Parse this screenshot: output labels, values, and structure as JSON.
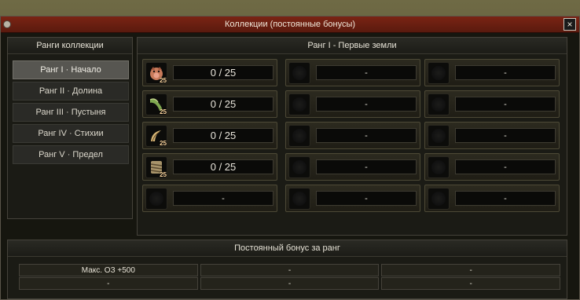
{
  "window": {
    "title": "Коллекции (постоянные бонусы)",
    "close_label": "×"
  },
  "ranks_panel": {
    "header": "Ранги коллекции",
    "items": [
      {
        "label": "Ранг I · Начало",
        "active": true
      },
      {
        "label": "Ранг II · Долина",
        "active": false
      },
      {
        "label": "Ранг III · Пустыня",
        "active": false
      },
      {
        "label": "Ранг IV · Стихии",
        "active": false
      },
      {
        "label": "Ранг V · Предел",
        "active": false
      }
    ]
  },
  "collection_panel": {
    "header": "Ранг I - Первые земли",
    "rows": [
      [
        {
          "icon": "pig-head-icon",
          "badge": "25",
          "value": "0 / 25"
        },
        {
          "icon": "",
          "badge": "",
          "value": "-"
        },
        {
          "icon": "",
          "badge": "",
          "value": "-"
        }
      ],
      [
        {
          "icon": "green-horn-icon",
          "badge": "25",
          "value": "0 / 25"
        },
        {
          "icon": "",
          "badge": "",
          "value": "-"
        },
        {
          "icon": "",
          "badge": "",
          "value": "-"
        }
      ],
      [
        {
          "icon": "claw-icon",
          "badge": "25",
          "value": "0 / 25"
        },
        {
          "icon": "",
          "badge": "",
          "value": "-"
        },
        {
          "icon": "",
          "badge": "",
          "value": "-"
        }
      ],
      [
        {
          "icon": "bone-bundle-icon",
          "badge": "25",
          "value": "0 / 25"
        },
        {
          "icon": "",
          "badge": "",
          "value": "-"
        },
        {
          "icon": "",
          "badge": "",
          "value": "-"
        }
      ],
      [
        {
          "icon": "",
          "badge": "",
          "value": "-"
        },
        {
          "icon": "",
          "badge": "",
          "value": "-"
        },
        {
          "icon": "",
          "badge": "",
          "value": "-"
        }
      ]
    ]
  },
  "bonus_panel": {
    "header": "Постоянный бонус за ранг",
    "rows": [
      [
        "Макс. ОЗ +500",
        "-",
        "-"
      ],
      [
        "-",
        "-",
        "-"
      ]
    ]
  }
}
